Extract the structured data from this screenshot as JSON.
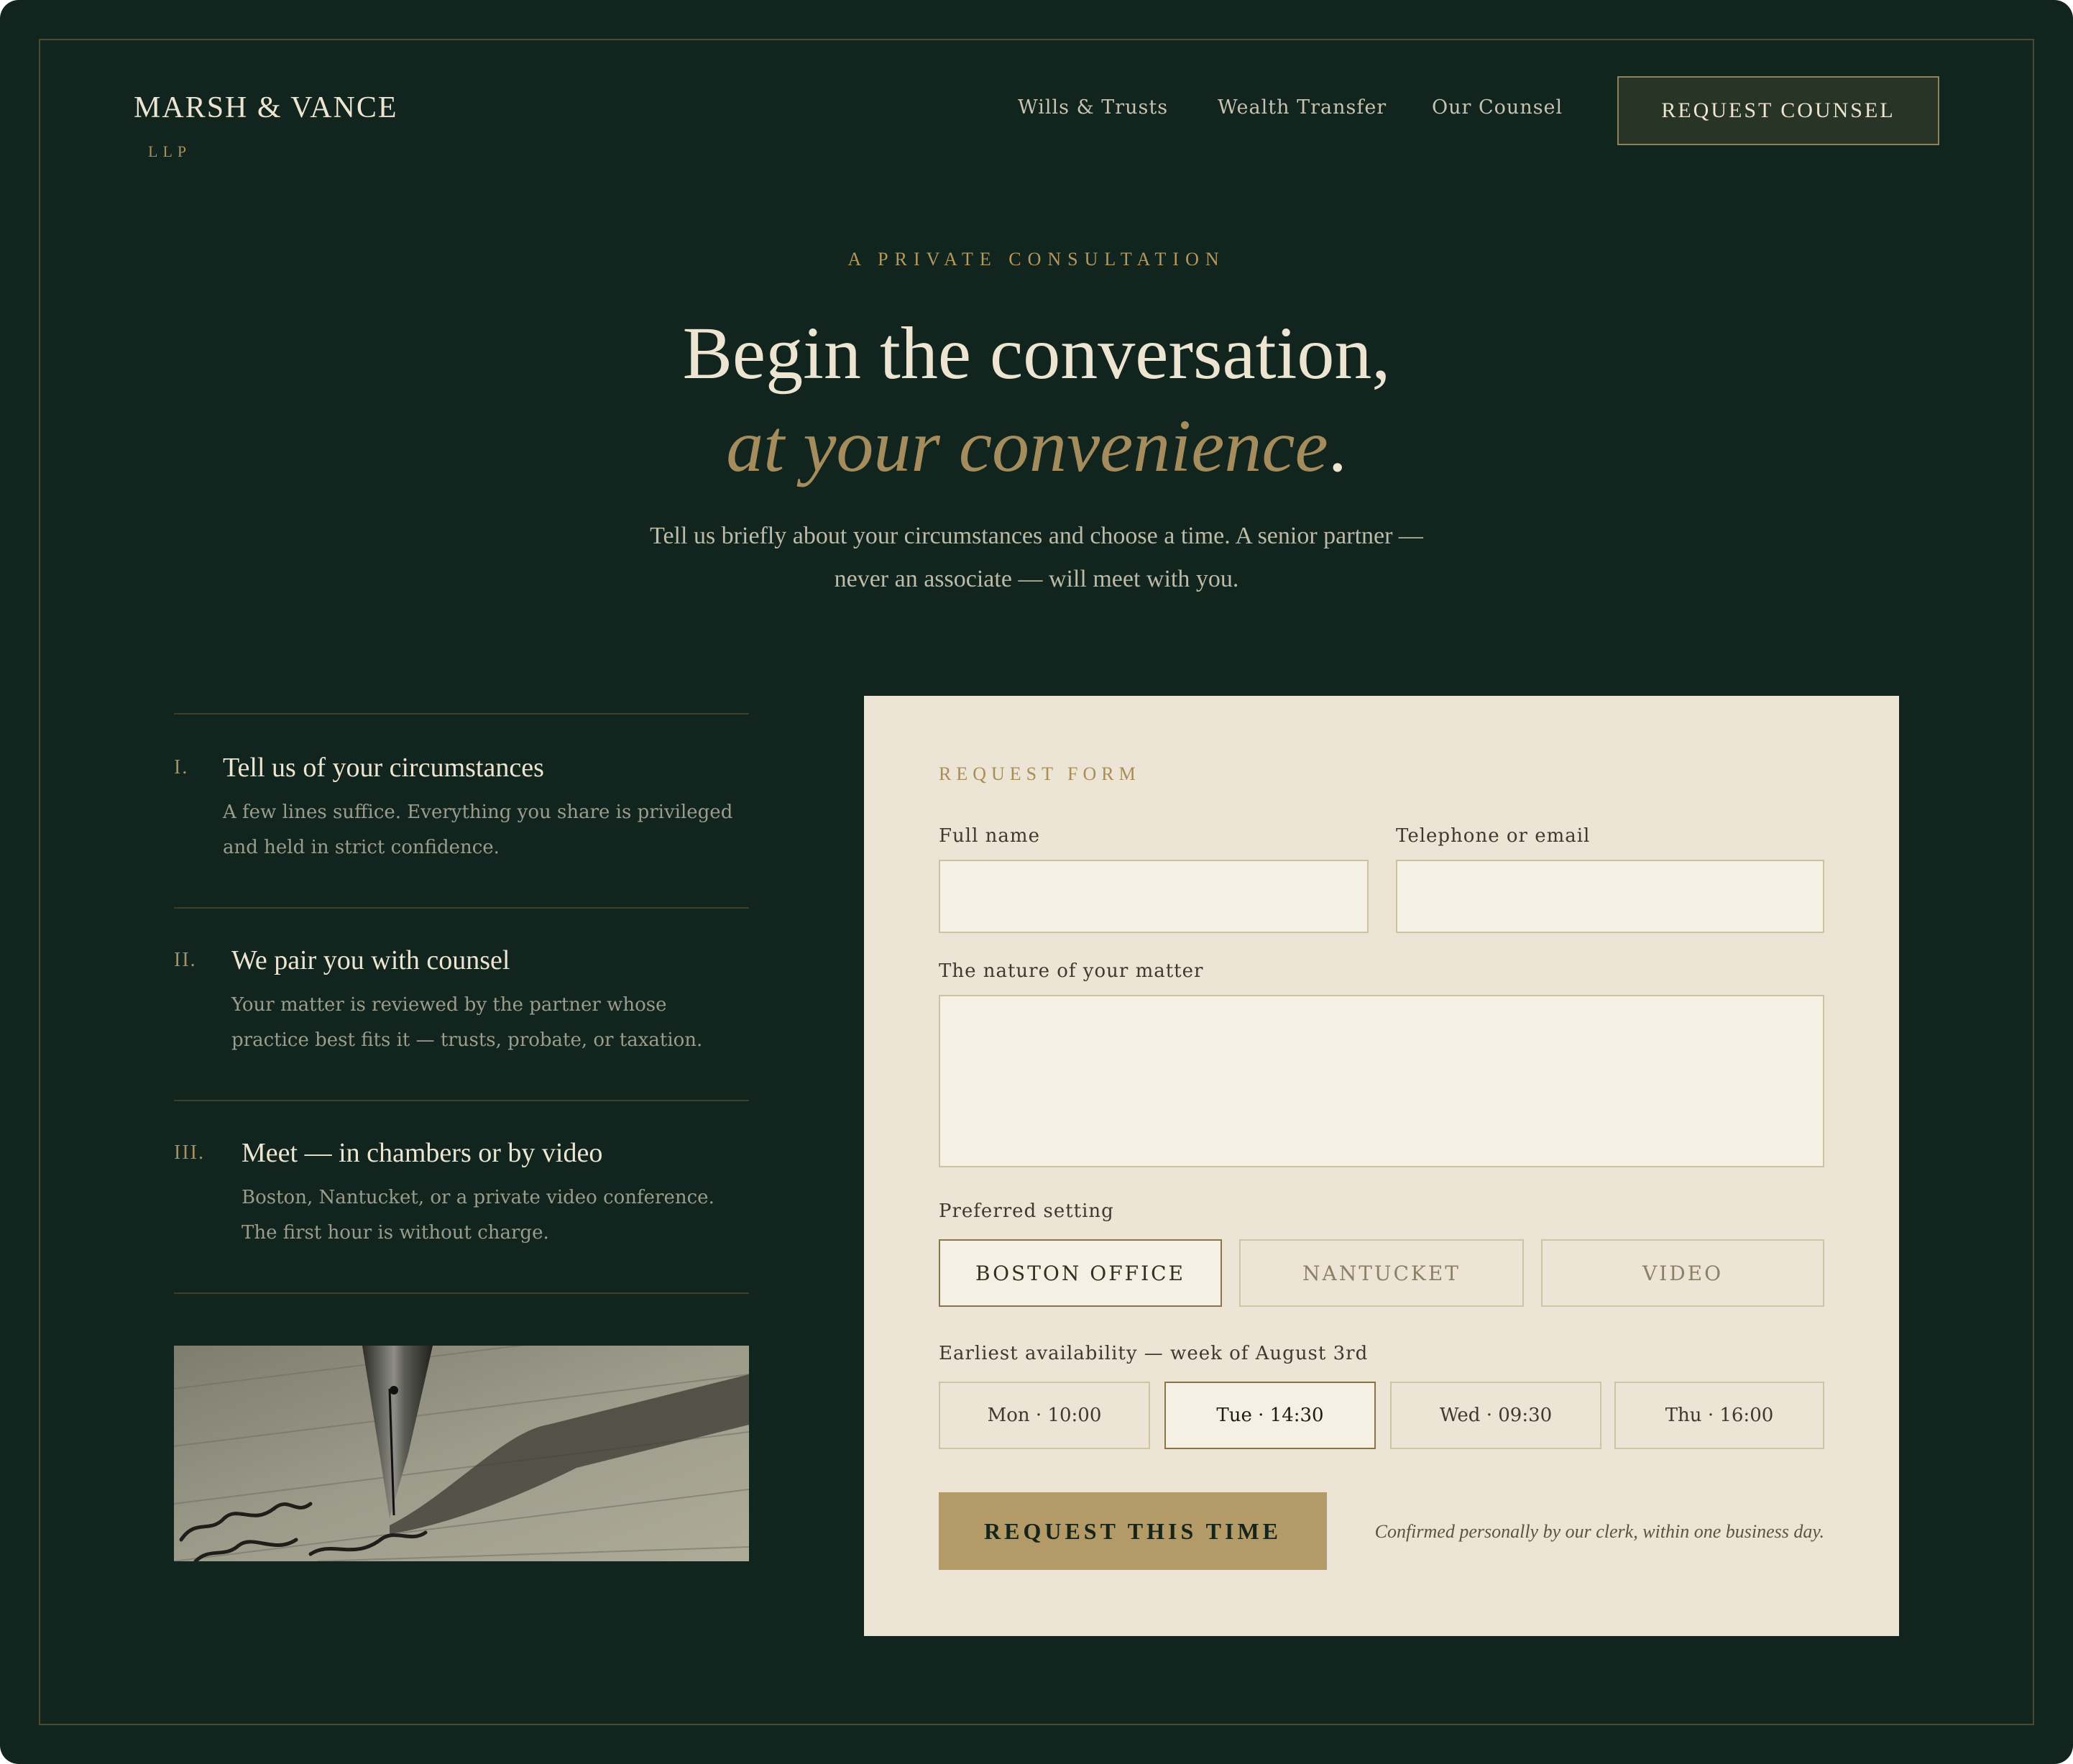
{
  "brand": {
    "name": "MARSH & VANCE",
    "suffix": "LLP"
  },
  "nav": {
    "links": [
      "Wills & Trusts",
      "Wealth Transfer",
      "Our Counsel"
    ],
    "cta": "REQUEST COUNSEL"
  },
  "hero": {
    "eyebrow": "A PRIVATE CONSULTATION",
    "title_line1": "Begin the conversation,",
    "title_line2_accent": "at your convenience",
    "title_line2_end": ".",
    "lede": "Tell us briefly about your circumstances and choose a time. A senior partner — never an associate — will meet with you."
  },
  "steps": [
    {
      "num": "I.",
      "title": "Tell us of your circumstances",
      "desc": "A few lines suffice. Everything you share is privileged and held in strict confidence."
    },
    {
      "num": "II.",
      "title": "We pair you with counsel",
      "desc": "Your matter is reviewed by the partner whose practice best fits it — trusts, probate, or taxation."
    },
    {
      "num": "III.",
      "title": "Meet — in chambers or by video",
      "desc": "Boston, Nantucket, or a private video conference. The first hour is without charge."
    }
  ],
  "form": {
    "eyebrow": "REQUEST FORM",
    "name_label": "Full name",
    "name_value": "",
    "contact_label": "Telephone or email",
    "contact_value": "",
    "matter_label": "The nature of your matter",
    "matter_value": "",
    "setting_label": "Preferred setting",
    "settings": [
      "BOSTON OFFICE",
      "NANTUCKET",
      "VIDEO"
    ],
    "settings_selected": "BOSTON OFFICE",
    "availability_label": "Earliest availability — week of August 3rd",
    "slots": [
      "Mon · 10:00",
      "Tue · 14:30",
      "Wed · 09:30",
      "Thu · 16:00"
    ],
    "slot_selected": "Tue · 14:30",
    "submit": "REQUEST THIS TIME",
    "note": "Confirmed personally by our clerk, within one business day."
  },
  "colors": {
    "background": "#11241d",
    "cream": "#ede4d1",
    "gold": "#b49a66",
    "form_bg": "#ece4d4"
  }
}
